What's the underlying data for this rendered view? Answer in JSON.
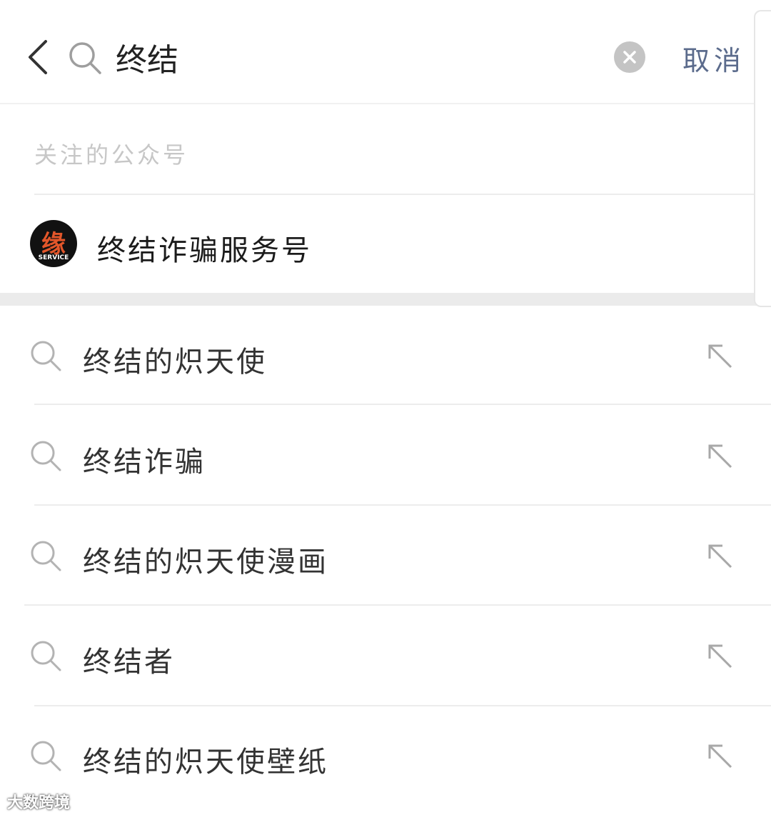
{
  "header": {
    "back_icon": "chevron-left-icon",
    "search_icon": "search-icon",
    "query": "终结",
    "clear_icon": "clear-circle-icon",
    "cancel_label": "取消"
  },
  "followed_accounts": {
    "section_label": "关注的公众号",
    "items": [
      {
        "name": "终结诈骗服务号",
        "avatar_char": "缘",
        "avatar_sub": "SERVICE",
        "avatar_bg": "#111111",
        "avatar_accent": "#e2562a"
      }
    ]
  },
  "suggestions": {
    "items": [
      {
        "text": "终结的炽天使"
      },
      {
        "text": "终结诈骗"
      },
      {
        "text": "终结的炽天使漫画"
      },
      {
        "text": "终结者"
      },
      {
        "text": "终结的炽天使壁纸"
      }
    ],
    "search_icon": "search-icon",
    "fill_icon": "arrow-up-left-icon"
  },
  "watermark": "大数跨境",
  "colors": {
    "caret": "#07c160",
    "cancel_text": "#5b6b8c",
    "section_text": "#c7c7c7"
  }
}
